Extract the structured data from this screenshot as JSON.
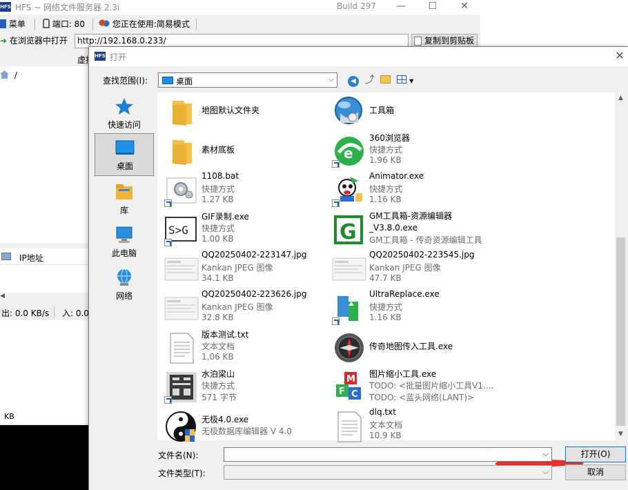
{
  "hfs": {
    "title": "HFS ~ 网络文件服务器 2.3i",
    "build": "Build 297",
    "logo": "HFS",
    "toolbar": {
      "menu": "菜单",
      "port": "端口: 80",
      "mode": "您正在使用:简易模式"
    },
    "open_in_browser": "在浏览器中打开",
    "url": "http://192.168.0.233/",
    "copy_clipboard": "复制到剪贴板",
    "vfs_header": "虚拟",
    "vfs_root": "/",
    "ip_header": "IP地址",
    "status_out": "出: 0.0 KB/s",
    "status_in": "入: 0.0",
    "log_kb": "KB"
  },
  "dialog": {
    "title": "打开",
    "lookin_label": "查找范围(I):",
    "lookin_value": "桌面",
    "places": [
      {
        "label": "快速访问"
      },
      {
        "label": "桌面"
      },
      {
        "label": "库"
      },
      {
        "label": "此电脑"
      },
      {
        "label": "网络"
      }
    ],
    "files": [
      {
        "name": "地图默认文件夹"
      },
      {
        "name": "工具箱"
      },
      {
        "name": "素材底板"
      },
      {
        "name": "360浏览器",
        "type": "快捷方式",
        "size": "1.96 KB"
      },
      {
        "name": "1108.bat",
        "type": "快捷方式",
        "size": "1.27 KB"
      },
      {
        "name": "Animator.exe",
        "type": "快捷方式",
        "size": "1.16 KB"
      },
      {
        "name": "GIF录制.exe",
        "type": "快捷方式",
        "size": "1.00 KB"
      },
      {
        "name": "GM工具箱-资源编辑器_V3.8.0.exe",
        "type": "GM工具箱 - 传奇资源编辑工具"
      },
      {
        "name": "QQ20250402-223147.jpg",
        "type": "Kankan JPEG 图像",
        "size": "34.1 KB"
      },
      {
        "name": "QQ20250402-223545.jpg",
        "type": "Kankan JPEG 图像",
        "size": "47.7 KB"
      },
      {
        "name": "QQ20250402-223626.jpg",
        "type": "Kankan JPEG 图像",
        "size": "32.8 KB"
      },
      {
        "name": "UltraReplace.exe",
        "type": "快捷方式",
        "size": "1.16 KB"
      },
      {
        "name": "版本测试.txt",
        "type": "文本文档",
        "size": "1.06 KB"
      },
      {
        "name": "传奇地图传入工具.exe"
      },
      {
        "name": "水泊梁山",
        "type": "快捷方式",
        "size": "571 字节"
      },
      {
        "name": "图片缩小工具.exe",
        "type": "TODO: <批量图片缩小工具V1....",
        "size": "TODO: <蓝头网络(LANT)>"
      },
      {
        "name": "无极4.0.exe",
        "type": "无极数据库编辑器 V 4.0"
      },
      {
        "name": "dlq.txt",
        "type": "文本文档",
        "size": "10.9 KB"
      }
    ],
    "filename_label": "文件名(N):",
    "filename_value": "",
    "filetype_label": "文件类型(T):",
    "filetype_value": "",
    "open_button": "打开(O)",
    "cancel_button": "取消",
    "accent_color": "#0078d7",
    "arrow_color": "#e8302a"
  }
}
